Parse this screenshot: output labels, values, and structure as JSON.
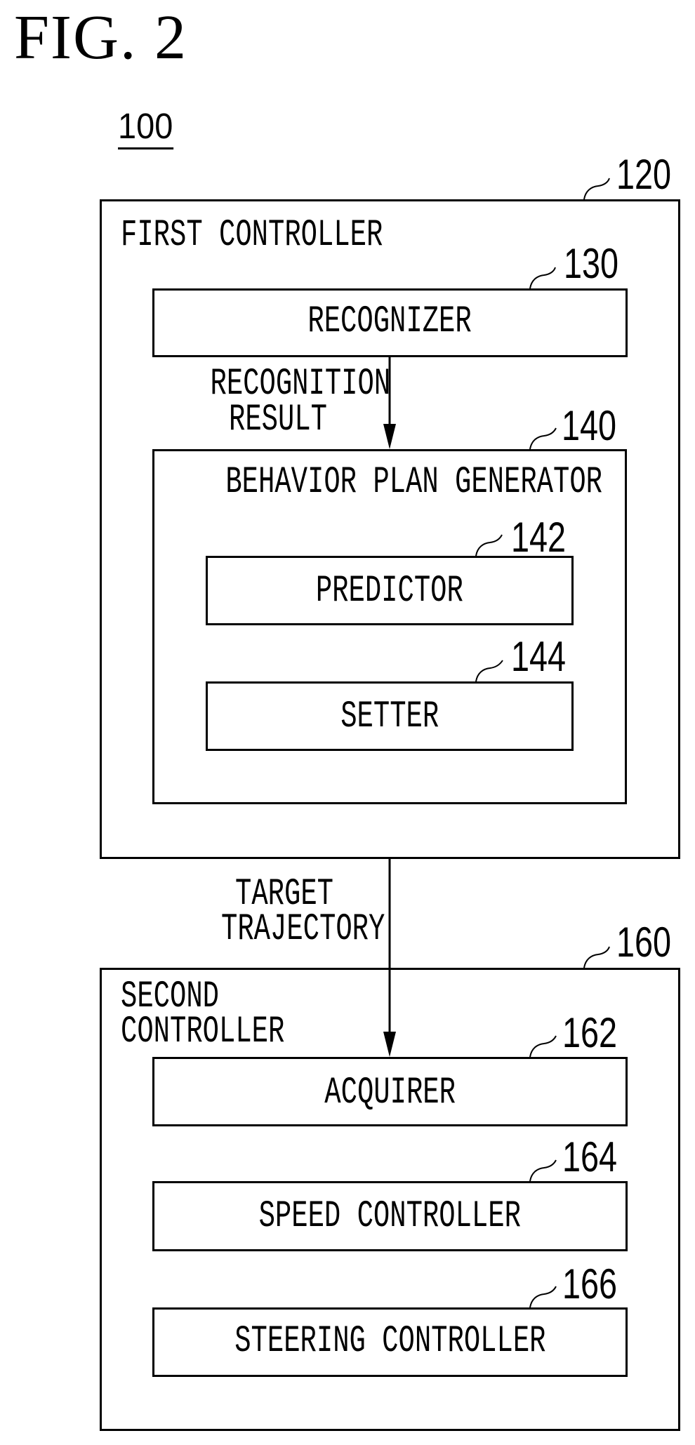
{
  "figure": {
    "title": "FIG. 2",
    "system_ref": "100"
  },
  "first_controller": {
    "ref": "120",
    "label": "FIRST CONTROLLER",
    "recognizer": {
      "ref": "130",
      "label": "RECOGNIZER"
    },
    "recognition_arrow": {
      "label_line1": "RECOGNITION",
      "label_line2": "RESULT"
    },
    "behavior_plan_generator": {
      "ref": "140",
      "label": "BEHAVIOR PLAN GENERATOR",
      "predictor": {
        "ref": "142",
        "label": "PREDICTOR"
      },
      "setter": {
        "ref": "144",
        "label": "SETTER"
      }
    }
  },
  "target_arrow": {
    "label_line1": "TARGET",
    "label_line2": "TRAJECTORY"
  },
  "second_controller": {
    "ref": "160",
    "label_line1": "SECOND",
    "label_line2": "CONTROLLER",
    "acquirer": {
      "ref": "162",
      "label": "ACQUIRER"
    },
    "speed_controller": {
      "ref": "164",
      "label": "SPEED CONTROLLER"
    },
    "steering_controller": {
      "ref": "166",
      "label": "STEERING CONTROLLER"
    }
  }
}
